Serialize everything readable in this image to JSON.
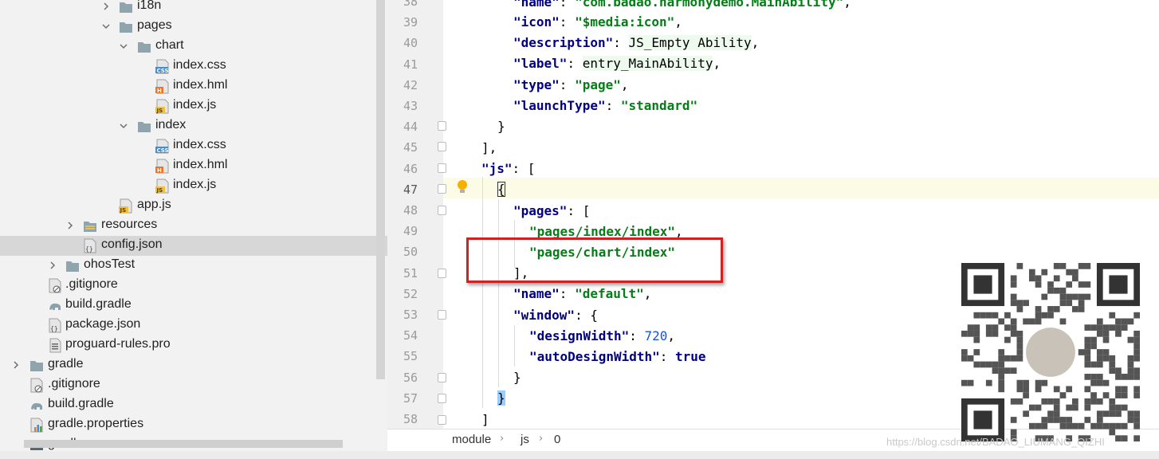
{
  "tree": [
    {
      "label": "i18n",
      "type": "folder",
      "expanded": false
    },
    {
      "label": "pages",
      "type": "folder",
      "expanded": true
    },
    {
      "label": "chart",
      "type": "folder",
      "expanded": true
    },
    {
      "label": "index.css",
      "type": "css"
    },
    {
      "label": "index.hml",
      "type": "hml"
    },
    {
      "label": "index.js",
      "type": "js"
    },
    {
      "label": "index",
      "type": "folder",
      "expanded": true
    },
    {
      "label": "index.css",
      "type": "css"
    },
    {
      "label": "index.hml",
      "type": "hml"
    },
    {
      "label": "index.js",
      "type": "js"
    },
    {
      "label": "app.js",
      "type": "js"
    },
    {
      "label": "resources",
      "type": "resfolder",
      "expanded": false
    },
    {
      "label": "config.json",
      "type": "json",
      "selected": true
    },
    {
      "label": "ohosTest",
      "type": "folder",
      "expanded": false
    },
    {
      "label": ".gitignore",
      "type": "git"
    },
    {
      "label": "build.gradle",
      "type": "gradle"
    },
    {
      "label": "package.json",
      "type": "json"
    },
    {
      "label": "proguard-rules.pro",
      "type": "file"
    },
    {
      "label": "gradle",
      "type": "folder",
      "expanded": false
    },
    {
      "label": ".gitignore",
      "type": "git"
    },
    {
      "label": "build.gradle",
      "type": "gradle"
    },
    {
      "label": "gradle.properties",
      "type": "props"
    },
    {
      "label": "gradlew",
      "type": "file"
    }
  ],
  "editor": {
    "line_numbers": [
      "38",
      "39",
      "40",
      "41",
      "42",
      "43",
      "44",
      "45",
      "46",
      "47",
      "48",
      "49",
      "50",
      "51",
      "52",
      "53",
      "54",
      "55",
      "56",
      "57",
      "58"
    ],
    "current_line": "47",
    "lines": {
      "l38": {
        "key": "\"name\"",
        "sep": ": ",
        "val": "\"com.badao.harmonydemo.MainAbility\"",
        "end": ","
      },
      "l39": {
        "key": "\"icon\"",
        "sep": ": ",
        "val": "\"$media:icon\"",
        "end": ","
      },
      "l40": {
        "key": "\"description\"",
        "sep": ": ",
        "val": "JS_Empty Ability",
        "end": ","
      },
      "l41": {
        "key": "\"label\"",
        "sep": ": ",
        "val": "entry_MainAbility",
        "end": ","
      },
      "l42": {
        "key": "\"type\"",
        "sep": ": ",
        "val": "\"page\"",
        "end": ","
      },
      "l43": {
        "key": "\"launchType\"",
        "sep": ": ",
        "val": "\"standard\""
      },
      "l44": "}",
      "l45": "],",
      "l46": {
        "key": "\"js\"",
        "sep": ": ",
        "end": "["
      },
      "l47": "{",
      "l48": {
        "key": "\"pages\"",
        "sep": ": ",
        "end": "["
      },
      "l49": {
        "val": "\"pages/index/index\"",
        "end": ","
      },
      "l50": {
        "val": "\"pages/chart/index\""
      },
      "l51": "],",
      "l52": {
        "key": "\"name\"",
        "sep": ": ",
        "val": "\"default\"",
        "end": ","
      },
      "l53": {
        "key": "\"window\"",
        "sep": ": ",
        "end": "{"
      },
      "l54": {
        "key": "\"designWidth\"",
        "sep": ": ",
        "val": "720",
        "end": ","
      },
      "l55": {
        "key": "\"autoDesignWidth\"",
        "sep": ": ",
        "val": "true"
      },
      "l56": "}",
      "l57": "}",
      "l58": "]"
    }
  },
  "breadcrumb": [
    "module",
    "js",
    "0"
  ],
  "watermark": "https://blog.csdn.net/BADAO_LIUMANG_QIZHI",
  "colors": {
    "key": "#000080",
    "string": "#067d17",
    "number": "#1750eb",
    "highlight_box": "#d32020"
  }
}
